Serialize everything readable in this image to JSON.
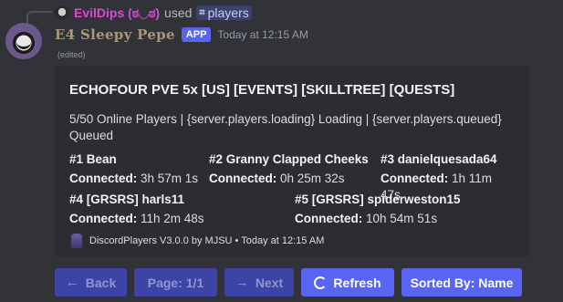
{
  "reply": {
    "user": "EvilDips (ಠ◡ಠ)",
    "used_text": "used",
    "command": "players",
    "command_icon": "slash-command-icon"
  },
  "message": {
    "author": "E4 Sleepy Pepe",
    "badge": "APP",
    "timestamp": "Today at 12:15 AM",
    "edited": "(edited)"
  },
  "embed": {
    "title": "ECHOFOUR PVE 5x [US] [EVENTS] [SKILLTREE] [QUESTS]",
    "description": "5/50 Online Players | {server.players.loading} Loading | {server.players.queued} Queued",
    "connected_label": "Connected:",
    "fields": [
      {
        "name": "#1 Bean",
        "value": "3h 57m 1s"
      },
      {
        "name": "#2 Granny Clapped Cheeks",
        "value": "0h 25m 32s"
      },
      {
        "name": "#3 danielquesada64",
        "value": "1h 11m 47s"
      },
      {
        "name": "#4 [GRSRS] harls11",
        "value": "11h 2m 48s"
      },
      {
        "name": "#5 [GRSRS] spiderweston15",
        "value": "10h 54m 51s"
      }
    ],
    "footer": "DiscordPlayers V3.0.0 by MJSU • Today at 12:15 AM",
    "accent_color": "#2b2d31"
  },
  "buttons": {
    "back": "Back",
    "page": "Page: 1/1",
    "next": "Next",
    "refresh": "Refresh",
    "sort": "Sorted By: Name"
  },
  "colors": {
    "background": "#313338",
    "blurple": "#5865f2",
    "blurple_disabled": "#3c45a5",
    "reply_name": "#d64bd6",
    "author_name": "#a89878"
  }
}
